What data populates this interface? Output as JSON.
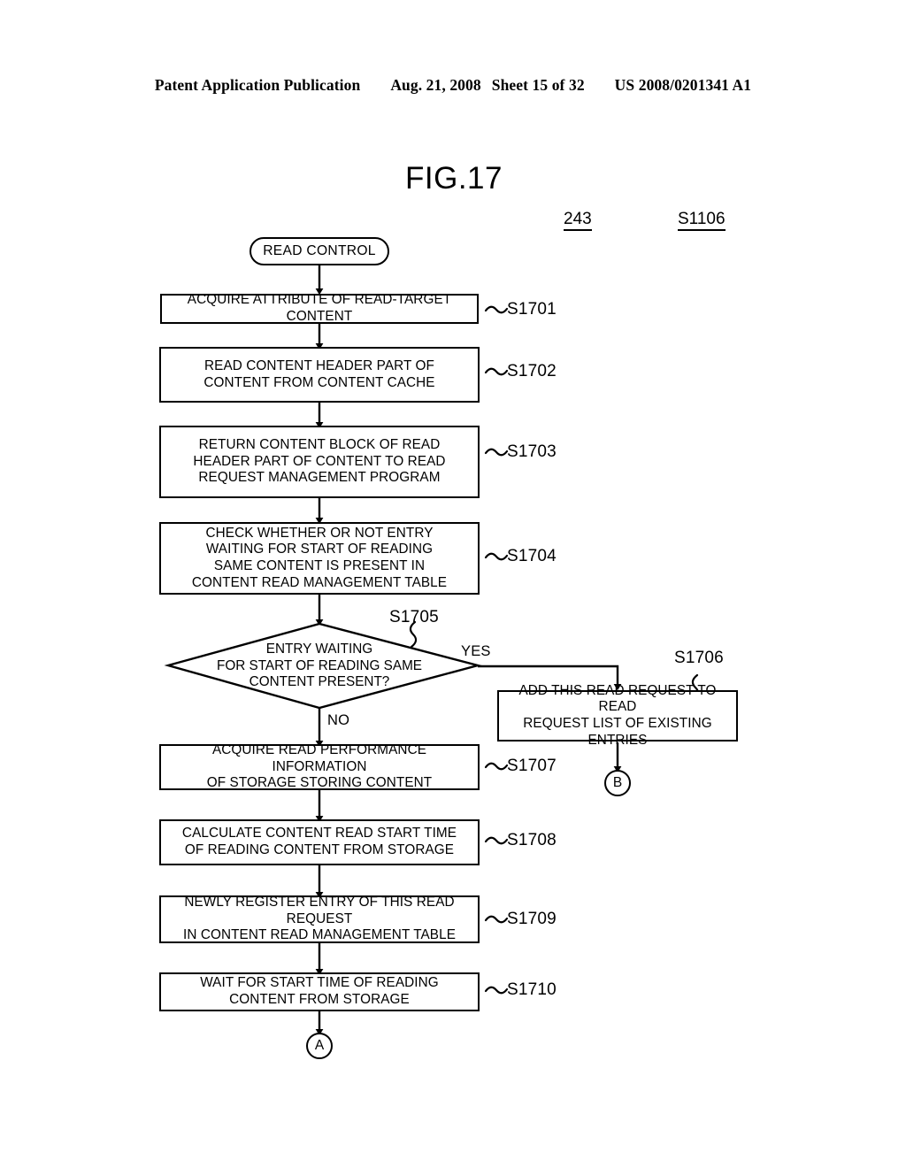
{
  "header": {
    "left": "Patent Application Publication",
    "date": "Aug. 21, 2008",
    "sheet": "Sheet 15 of 32",
    "pub_number": "US 2008/0201341 A1"
  },
  "figure": {
    "title": "FIG.17",
    "ref_numbers": [
      {
        "name": "program-ref",
        "text": "243"
      },
      {
        "name": "step-ref",
        "text": "S1106"
      }
    ]
  },
  "flow": {
    "start": {
      "label": "READ CONTROL"
    },
    "steps": [
      {
        "id": "S1701",
        "text": "ACQUIRE ATTRIBUTE OF READ-TARGET CONTENT",
        "step_label": "S1701"
      },
      {
        "id": "S1702",
        "text": "READ CONTENT HEADER PART OF\nCONTENT FROM CONTENT CACHE",
        "step_label": "S1702"
      },
      {
        "id": "S1703",
        "text": "RETURN CONTENT BLOCK OF READ\nHEADER PART OF CONTENT TO READ\nREQUEST MANAGEMENT PROGRAM",
        "step_label": "S1703"
      },
      {
        "id": "S1704",
        "text": "CHECK WHETHER OR NOT ENTRY\nWAITING FOR START OF READING\nSAME CONTENT IS PRESENT IN\nCONTENT READ MANAGEMENT TABLE",
        "step_label": "S1704"
      },
      {
        "id": "S1707",
        "text": "ACQUIRE READ PERFORMANCE INFORMATION\nOF STORAGE STORING CONTENT",
        "step_label": "S1707"
      },
      {
        "id": "S1708",
        "text": "CALCULATE CONTENT READ START TIME\nOF READING CONTENT FROM STORAGE",
        "step_label": "S1708"
      },
      {
        "id": "S1709",
        "text": "NEWLY REGISTER ENTRY OF THIS READ REQUEST\nIN CONTENT READ MANAGEMENT TABLE",
        "step_label": "S1709"
      },
      {
        "id": "S1710",
        "text": "WAIT FOR START TIME OF READING\nCONTENT FROM STORAGE",
        "step_label": "S1710"
      }
    ],
    "decision": {
      "id": "S1705",
      "text": "ENTRY WAITING\nFOR START OF READING SAME\nCONTENT PRESENT?",
      "step_label": "S1705",
      "yes_label": "YES",
      "no_label": "NO"
    },
    "branch_step": {
      "id": "S1706",
      "text": "ADD THIS READ REQUEST TO READ\nREQUEST LIST OF EXISTING ENTRIES",
      "step_label": "S1706"
    },
    "connectors": [
      {
        "name": "connector-b",
        "label": "B"
      },
      {
        "name": "connector-a",
        "label": "A"
      }
    ]
  }
}
